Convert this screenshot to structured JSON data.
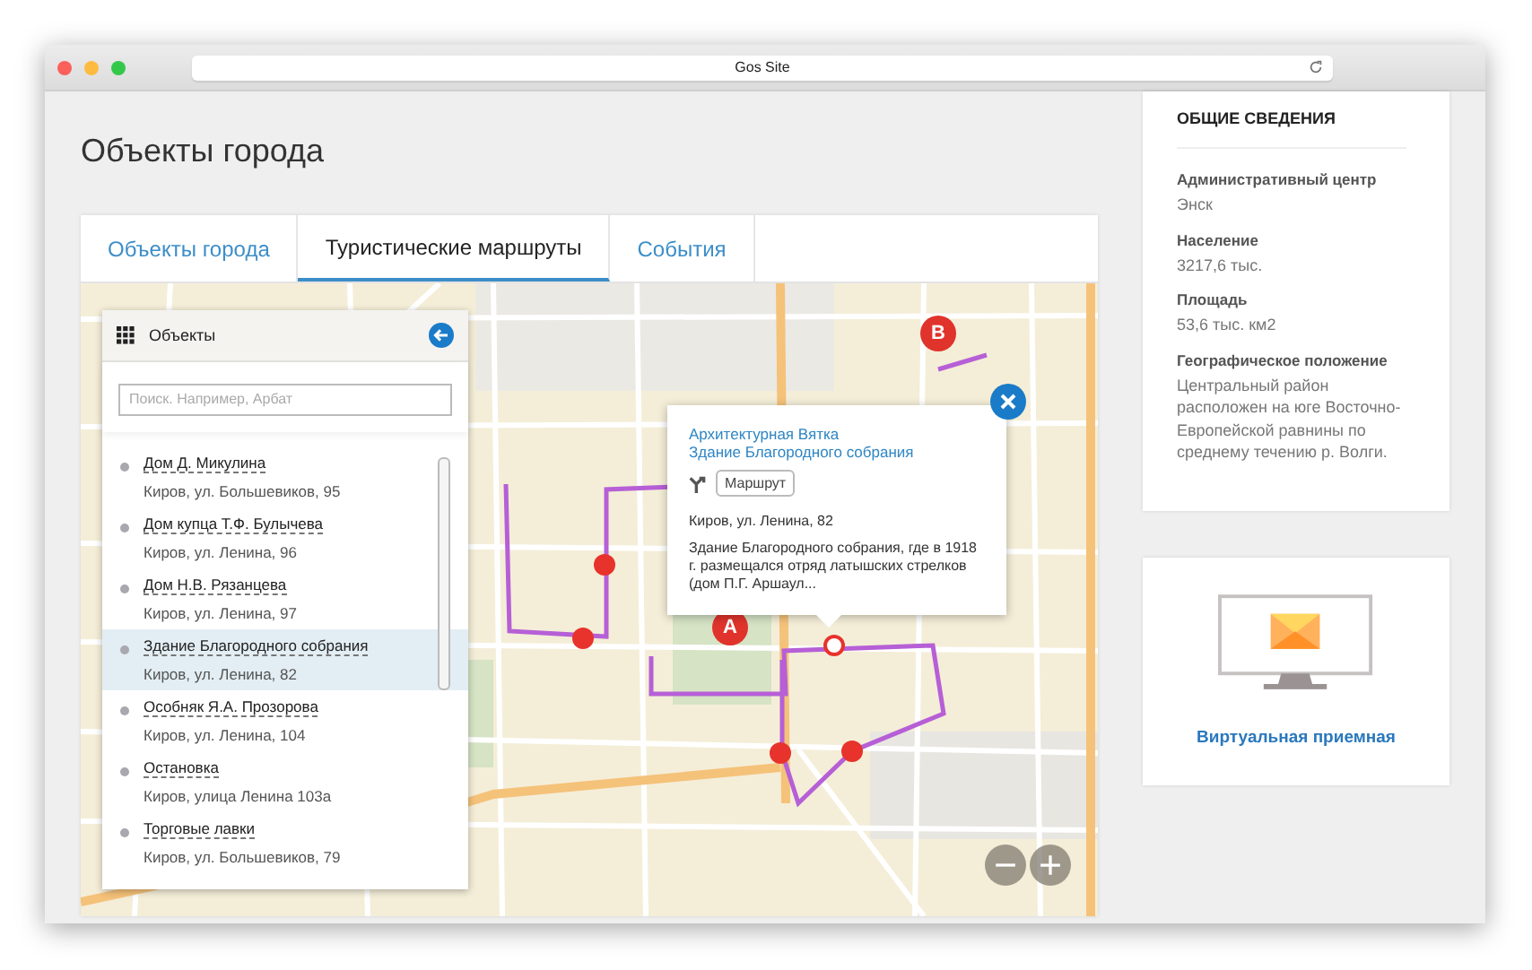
{
  "window": {
    "title": "Gos Site"
  },
  "page": {
    "title": "Объекты города"
  },
  "tabs": [
    {
      "label": "Объекты города",
      "selected": false
    },
    {
      "label": "Туристические маршруты",
      "selected": true
    },
    {
      "label": "События",
      "selected": false
    }
  ],
  "objects_panel": {
    "title": "Объекты",
    "search": {
      "placeholder": "Поиск. Например, Арбат"
    },
    "items": [
      {
        "name": "Дом Д. Микулина",
        "address": "Киров, ул. Большевиков, 95",
        "selected": false
      },
      {
        "name": "Дом купца Т.Ф. Булычева",
        "address": "Киров, ул. Ленина, 96",
        "selected": false
      },
      {
        "name": "Дом Н.В. Рязанцева",
        "address": "Киров, ул. Ленина, 97",
        "selected": false
      },
      {
        "name": "Здание Благородного собрания",
        "address": "Киров, ул. Ленина, 82",
        "selected": true
      },
      {
        "name": "Особняк Я.А. Прозорова",
        "address": "Киров, ул. Ленина, 104",
        "selected": false
      },
      {
        "name": "Остановка",
        "address": "Киров, улица Ленина 103а",
        "selected": false
      },
      {
        "name": "Торговые лавки",
        "address": "Киров, ул. Большевиков, 79",
        "selected": false
      }
    ]
  },
  "map": {
    "markers": [
      {
        "label": "A"
      },
      {
        "label": "B"
      }
    ]
  },
  "popup": {
    "title_lines": [
      "Архитектурная Вятка",
      "Здание Благородного собрания"
    ],
    "route_button": "Маршрут",
    "address": "Киров, ул. Ленина, 82",
    "description": "Здание Благородного собрания, где в 1918 г. размещался отряд латышских стрелков (дом П.Г. Аршаул..."
  },
  "info": {
    "heading": "ОБЩИЕ СВЕДЕНИЯ",
    "fields": [
      {
        "label": "Административный центр",
        "value": "Энск"
      },
      {
        "label": "Население",
        "value": "3217,6 тыс."
      },
      {
        "label": "Площадь",
        "value": "53,6 тыс. км2"
      },
      {
        "label": "Географическое положение",
        "value": "Центральный район расположен на юге Восточно-Европейской равнины по среднему течению р. Волги."
      }
    ]
  },
  "virtual_reception": {
    "label": "Виртуальная приемная"
  }
}
